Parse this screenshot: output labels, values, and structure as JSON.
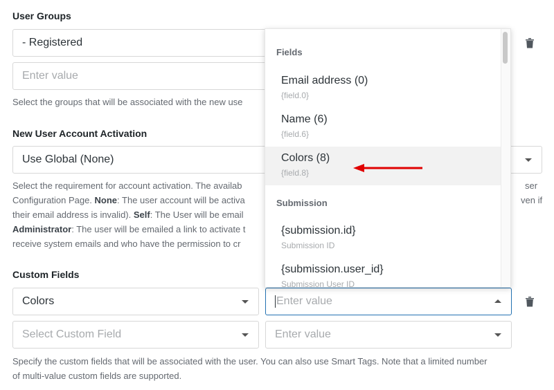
{
  "user_groups": {
    "label": "User Groups",
    "selected": "- Registered",
    "input_placeholder": "Enter value",
    "help": "Select the groups that will be associated with the new use"
  },
  "activation": {
    "label": "New User Account Activation",
    "selected": "Use Global (None)",
    "help": {
      "line1": "Select the requirement for account activation. The availab",
      "line1_tail": "ser",
      "line2_pre": "Configuration Page. ",
      "line2_b": "None",
      "line2_post": ": The user account will be activa",
      "line2_tail": "ven if",
      "line3_pre": "their email address is invalid). ",
      "line3_b": "Self",
      "line3_post": ": The User will be email",
      "line4_b": "Administrator",
      "line4_post": ": The user will be emailed a link to activate t",
      "line5": "receive system emails and who have the permission to cr"
    }
  },
  "custom_fields": {
    "label": "Custom Fields",
    "row1_field": "Colors",
    "row1_value_placeholder": "Enter value",
    "row2_field_placeholder": "Select Custom Field",
    "row2_value_placeholder": "Enter value",
    "help_line1": "Specify the custom fields that will be associated with the user. You can also use Smart Tags. Note that a limited number",
    "help_line2": "of multi-value custom fields are supported."
  },
  "dropdown": {
    "groups": [
      {
        "title": "Fields",
        "items": [
          {
            "label": "Email address (0)",
            "tag": "{field.0}"
          },
          {
            "label": "Name (6)",
            "tag": "{field.6}"
          },
          {
            "label": "Colors (8)",
            "tag": "{field.8}",
            "highlighted": true
          }
        ]
      },
      {
        "title": "Submission",
        "items": [
          {
            "label": "{submission.id}",
            "tag": "Submission ID"
          },
          {
            "label": "{submission.user_id}",
            "tag": "Submission User ID"
          }
        ]
      }
    ]
  },
  "icons": {
    "delete": "trash-icon",
    "select_toggle": "caret-down-icon",
    "annotation": "red-arrow"
  },
  "colors": {
    "annotation_arrow": "#e00000",
    "highlight_bg": "#f2f2f2"
  }
}
